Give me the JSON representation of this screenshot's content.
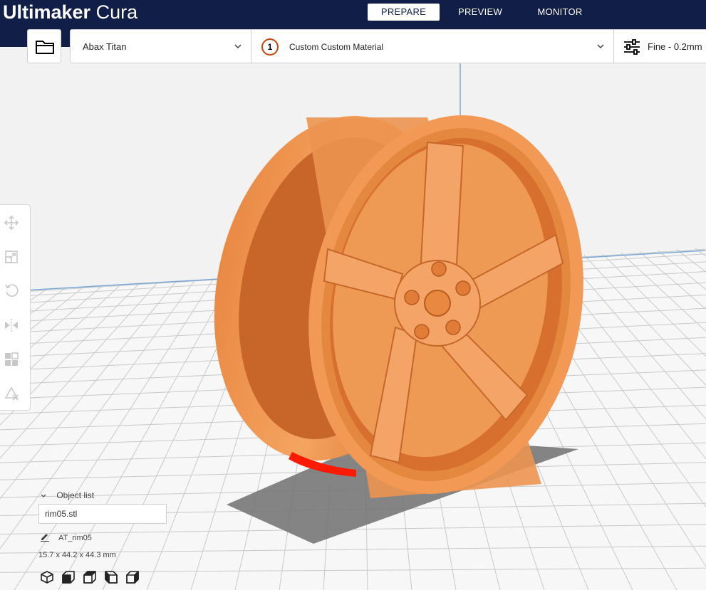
{
  "app": {
    "logo_bold": "Ultimaker",
    "logo_light": " Cura"
  },
  "stages": [
    {
      "label": "PREPARE",
      "active": true
    },
    {
      "label": "PREVIEW",
      "active": false
    },
    {
      "label": "MONITOR",
      "active": false
    }
  ],
  "toolbar": {
    "open_icon": "folder-icon",
    "printer": "Abax Titan",
    "extruder_number": "1",
    "material": "Custom Custom Material",
    "profile_icon": "settings-sliders-icon",
    "profile": "Fine - 0.2mm"
  },
  "tools": [
    {
      "name": "move-tool",
      "icon": "move-icon"
    },
    {
      "name": "scale-tool",
      "icon": "scale-icon"
    },
    {
      "name": "rotate-tool",
      "icon": "rotate-icon"
    },
    {
      "name": "mirror-tool",
      "icon": "mirror-icon"
    },
    {
      "name": "per-model-settings-tool",
      "icon": "per-model-settings-icon"
    },
    {
      "name": "support-blocker-tool",
      "icon": "support-blocker-icon"
    }
  ],
  "object_list": {
    "toggle_label": "Object list",
    "file": "rim05.stl",
    "object_name": "AT_rim05",
    "dimensions": "15.7 x 44.2 x 44.3 mm"
  },
  "view_buttons": [
    "3d-view-icon",
    "front-view-icon",
    "top-view-icon",
    "left-view-icon",
    "right-view-icon"
  ],
  "colors": {
    "header": "#101e48",
    "model": "#f0a060",
    "overhang": "#ff0000",
    "build_plate": "#f5f5f5",
    "shadow": "#777777"
  }
}
